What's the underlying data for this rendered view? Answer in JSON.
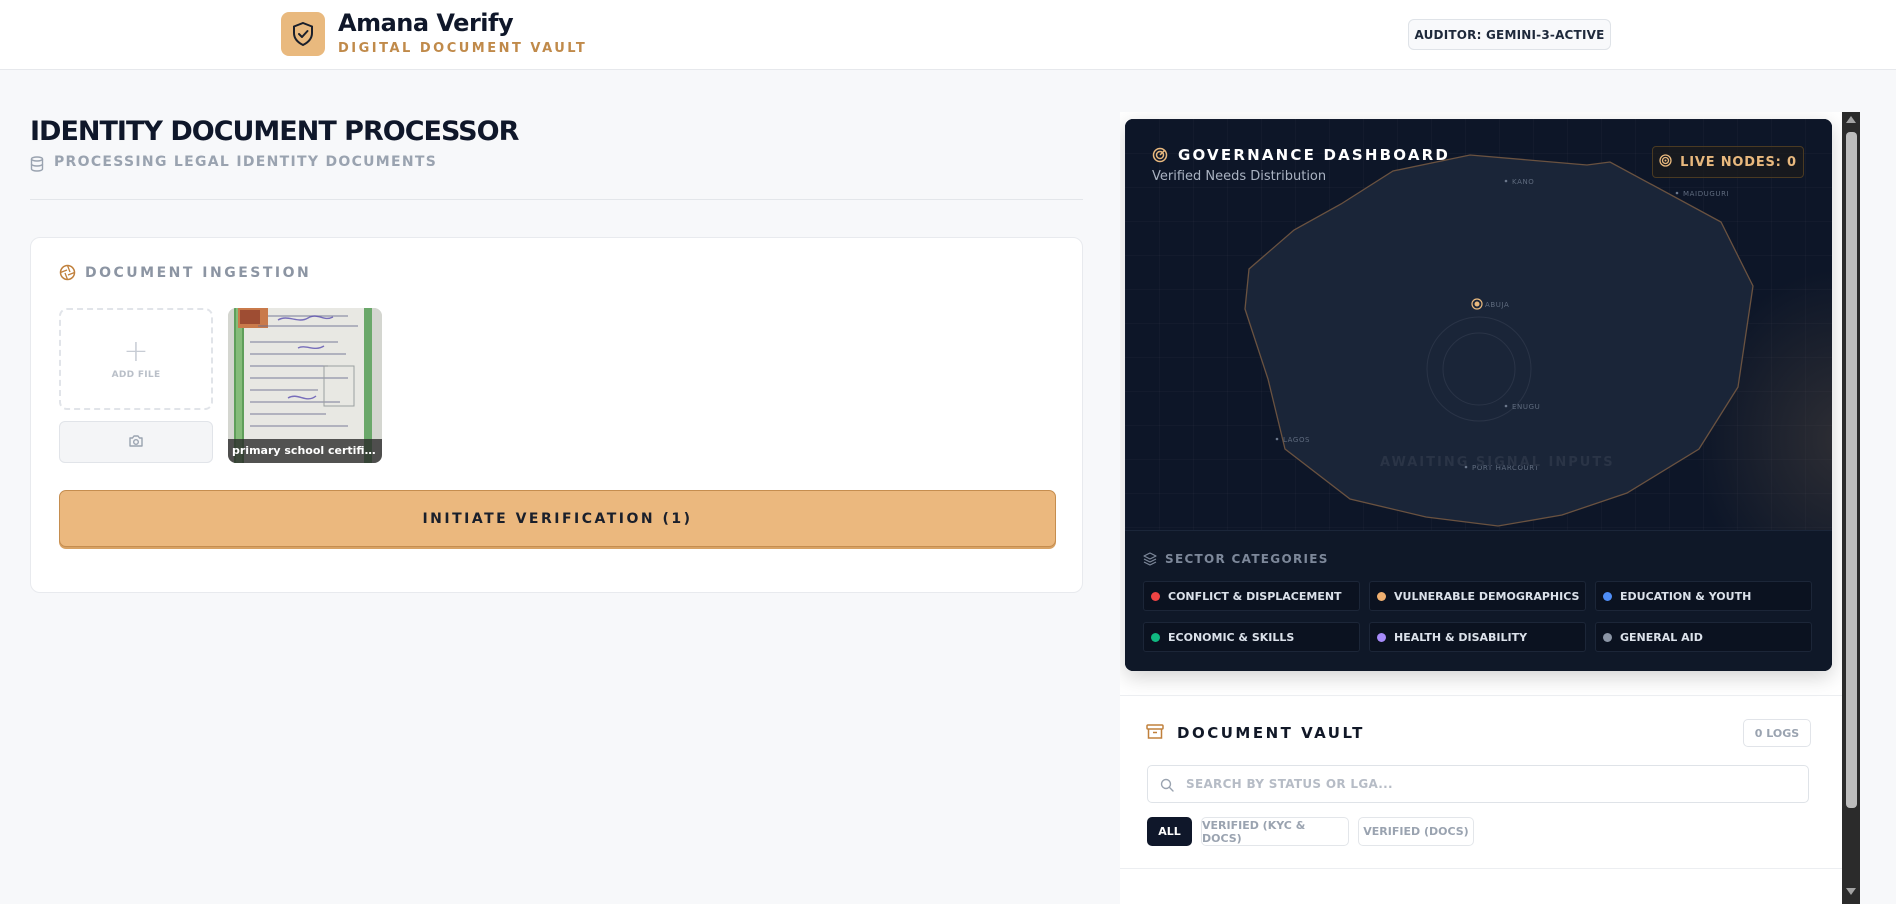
{
  "header": {
    "app_name": "Amana Verify",
    "app_subtitle": "DIGITAL DOCUMENT VAULT",
    "auditor": "AUDITOR: GEMINI-3-ACTIVE",
    "logo_icon": "shield-check-icon"
  },
  "page": {
    "title": "IDENTITY DOCUMENT PROCESSOR",
    "subtitle": "PROCESSING LEGAL IDENTITY DOCUMENTS"
  },
  "ingestion": {
    "title": "DOCUMENT INGESTION",
    "add_file_label": "ADD FILE",
    "files": [
      {
        "name": "primary school certificate.j..."
      }
    ],
    "verify_button": "INITIATE VERIFICATION (1)"
  },
  "dashboard": {
    "title": "GOVERNANCE DASHBOARD",
    "subtitle": "Verified Needs Distribution",
    "live_nodes": "LIVE NODES: 0",
    "awaiting": "AWAITING SIGNAL INPUTS",
    "cities": [
      "KANO",
      "MAIDUGURI",
      "ABUJA",
      "ENUGU",
      "LAGOS",
      "PORT HARCOURT"
    ],
    "sector_title": "SECTOR CATEGORIES",
    "categories": [
      {
        "label": "CONFLICT & DISPLACEMENT",
        "color": "#ef4444"
      },
      {
        "label": "VULNERABLE DEMOGRAPHICS",
        "color": "#f0b070"
      },
      {
        "label": "EDUCATION & YOUTH",
        "color": "#4f8ef7"
      },
      {
        "label": "ECONOMIC & SKILLS",
        "color": "#10b981"
      },
      {
        "label": "HEALTH & DISABILITY",
        "color": "#a78bfa"
      },
      {
        "label": "GENERAL AID",
        "color": "#8b95a5"
      }
    ]
  },
  "vault": {
    "title": "DOCUMENT VAULT",
    "logs": "0 LOGS",
    "search_placeholder": "SEARCH BY STATUS OR LGA...",
    "filters": [
      "ALL",
      "VERIFIED (KYC & DOCS)",
      "VERIFIED (DOCS)"
    ]
  },
  "colors": {
    "accent": "#e9b97e",
    "dark": "#0c1424"
  }
}
